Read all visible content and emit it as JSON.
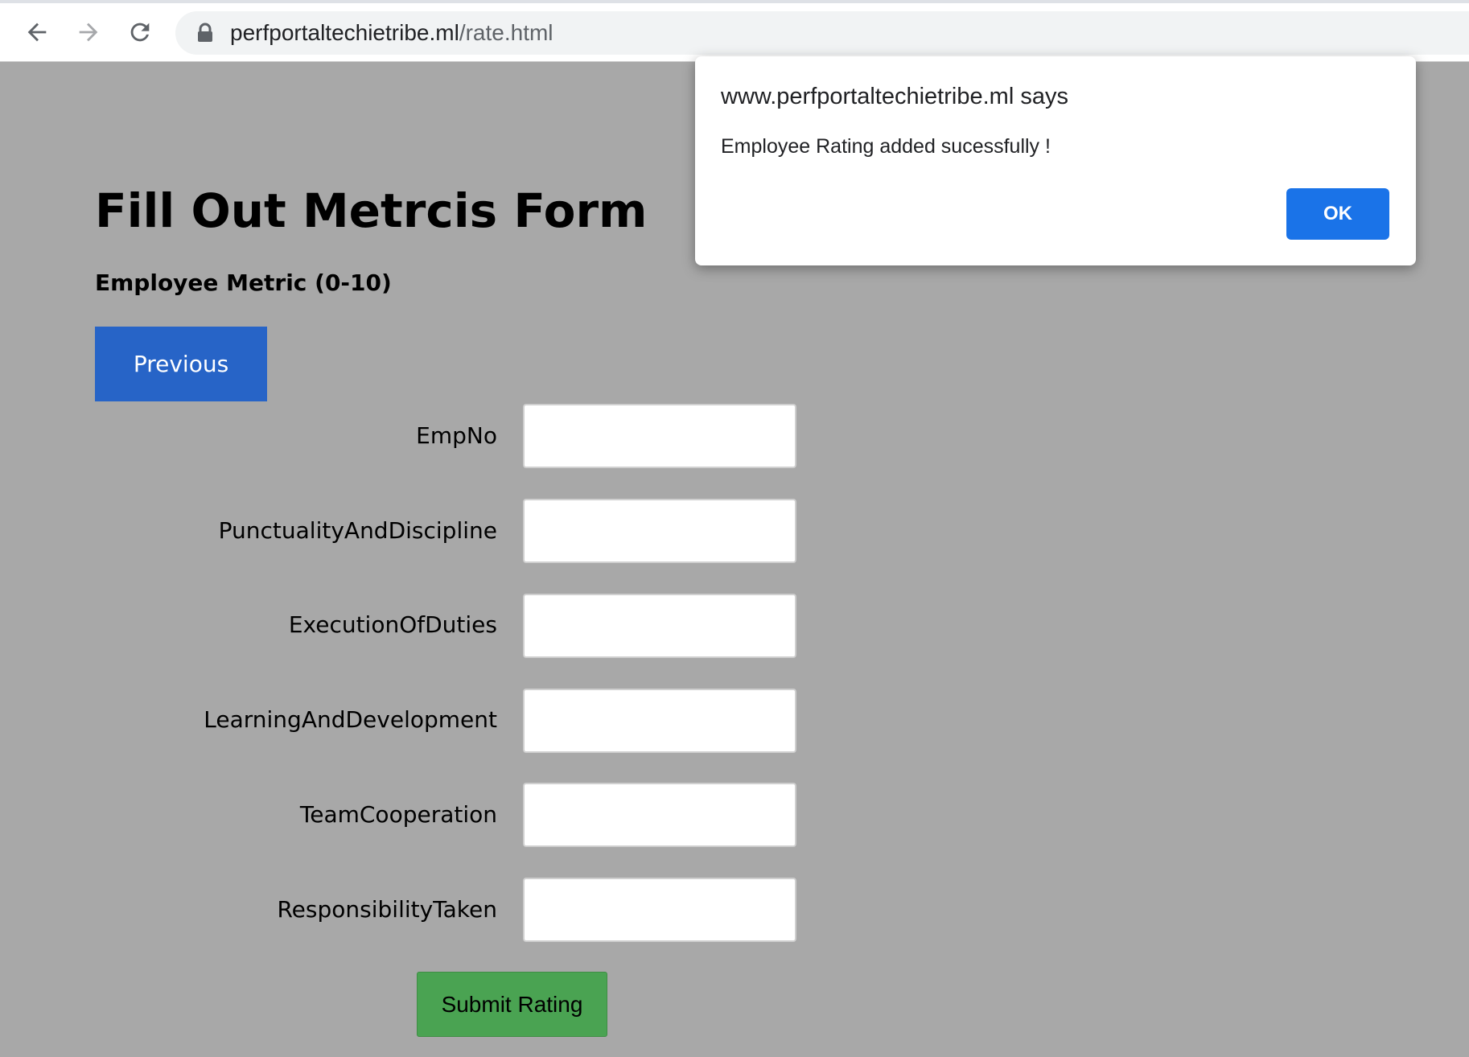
{
  "browser": {
    "url_host": "perfportaltechietribe.ml",
    "url_path": "/rate.html",
    "icons": {
      "back": "back-arrow-icon",
      "forward": "forward-arrow-icon",
      "reload": "reload-icon",
      "lock": "lock-icon"
    }
  },
  "page": {
    "title": "Fill Out Metrcis Form",
    "subtitle": "Employee Metric (0-10)",
    "previous_label": "Previous",
    "fields": [
      {
        "label": "EmpNo",
        "value": ""
      },
      {
        "label": "PunctualityAndDiscipline",
        "value": ""
      },
      {
        "label": "ExecutionOfDuties",
        "value": ""
      },
      {
        "label": "LearningAndDevelopment",
        "value": ""
      },
      {
        "label": "TeamCooperation",
        "value": ""
      },
      {
        "label": "ResponsibilityTaken",
        "value": ""
      }
    ],
    "submit_label": "Submit Rating"
  },
  "dialog": {
    "title": "www.perfportaltechietribe.ml says",
    "message": "Employee Rating added sucessfully !",
    "ok_label": "OK"
  },
  "colors": {
    "page_background": "#a8a8a8",
    "previous_button": "#2764c7",
    "submit_button": "#4aa352",
    "ok_button": "#1a73e8"
  }
}
